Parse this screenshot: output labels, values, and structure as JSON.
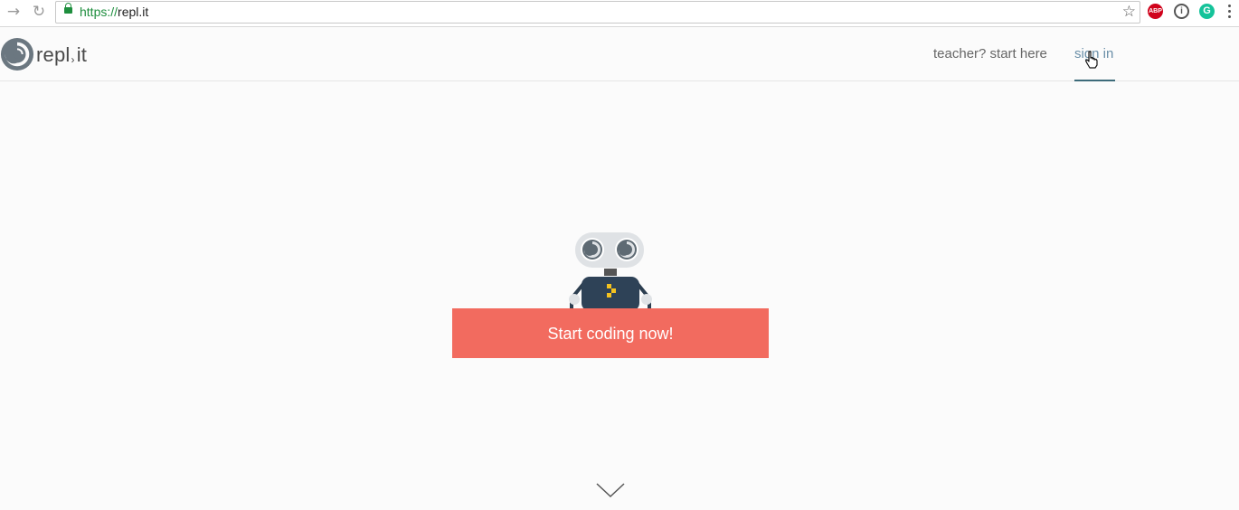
{
  "browser": {
    "url_scheme": "https://",
    "url_host": "repl.it",
    "icons": [
      "forward-icon",
      "reload-icon",
      "lock-icon",
      "bookmark-star-icon",
      "adblock-extension-icon",
      "password-extension-icon",
      "grammarly-extension-icon",
      "menu-icon"
    ],
    "abp_label": "ABP",
    "info_label": "i",
    "grammarly_label": "G"
  },
  "header": {
    "logo_text_left": "repl",
    "logo_text_sep": "›",
    "logo_text_right": "it",
    "nav": [
      {
        "label": "teacher? start here"
      },
      {
        "label": "sign in"
      }
    ]
  },
  "hero": {
    "cta_label": "Start coding now!"
  },
  "colors": {
    "accent": "#f26b5f",
    "nav_active": "#6a8fa8",
    "underline": "#3d6b7a",
    "secure_green": "#1e8e3e"
  }
}
